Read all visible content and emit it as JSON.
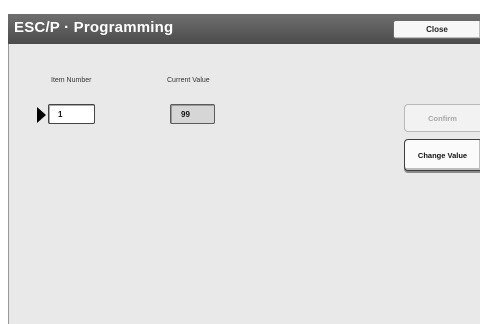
{
  "window": {
    "title": "ESC/P · Programming",
    "close_label": "Close"
  },
  "form": {
    "item_number_label": "Item Number",
    "item_number_value": "1",
    "current_value_label": "Current Value",
    "current_value": "99"
  },
  "actions": {
    "confirm_label": "Confirm",
    "change_value_label": "Change Value"
  },
  "icons": {
    "selection_arrow": "arrow-right-icon"
  }
}
